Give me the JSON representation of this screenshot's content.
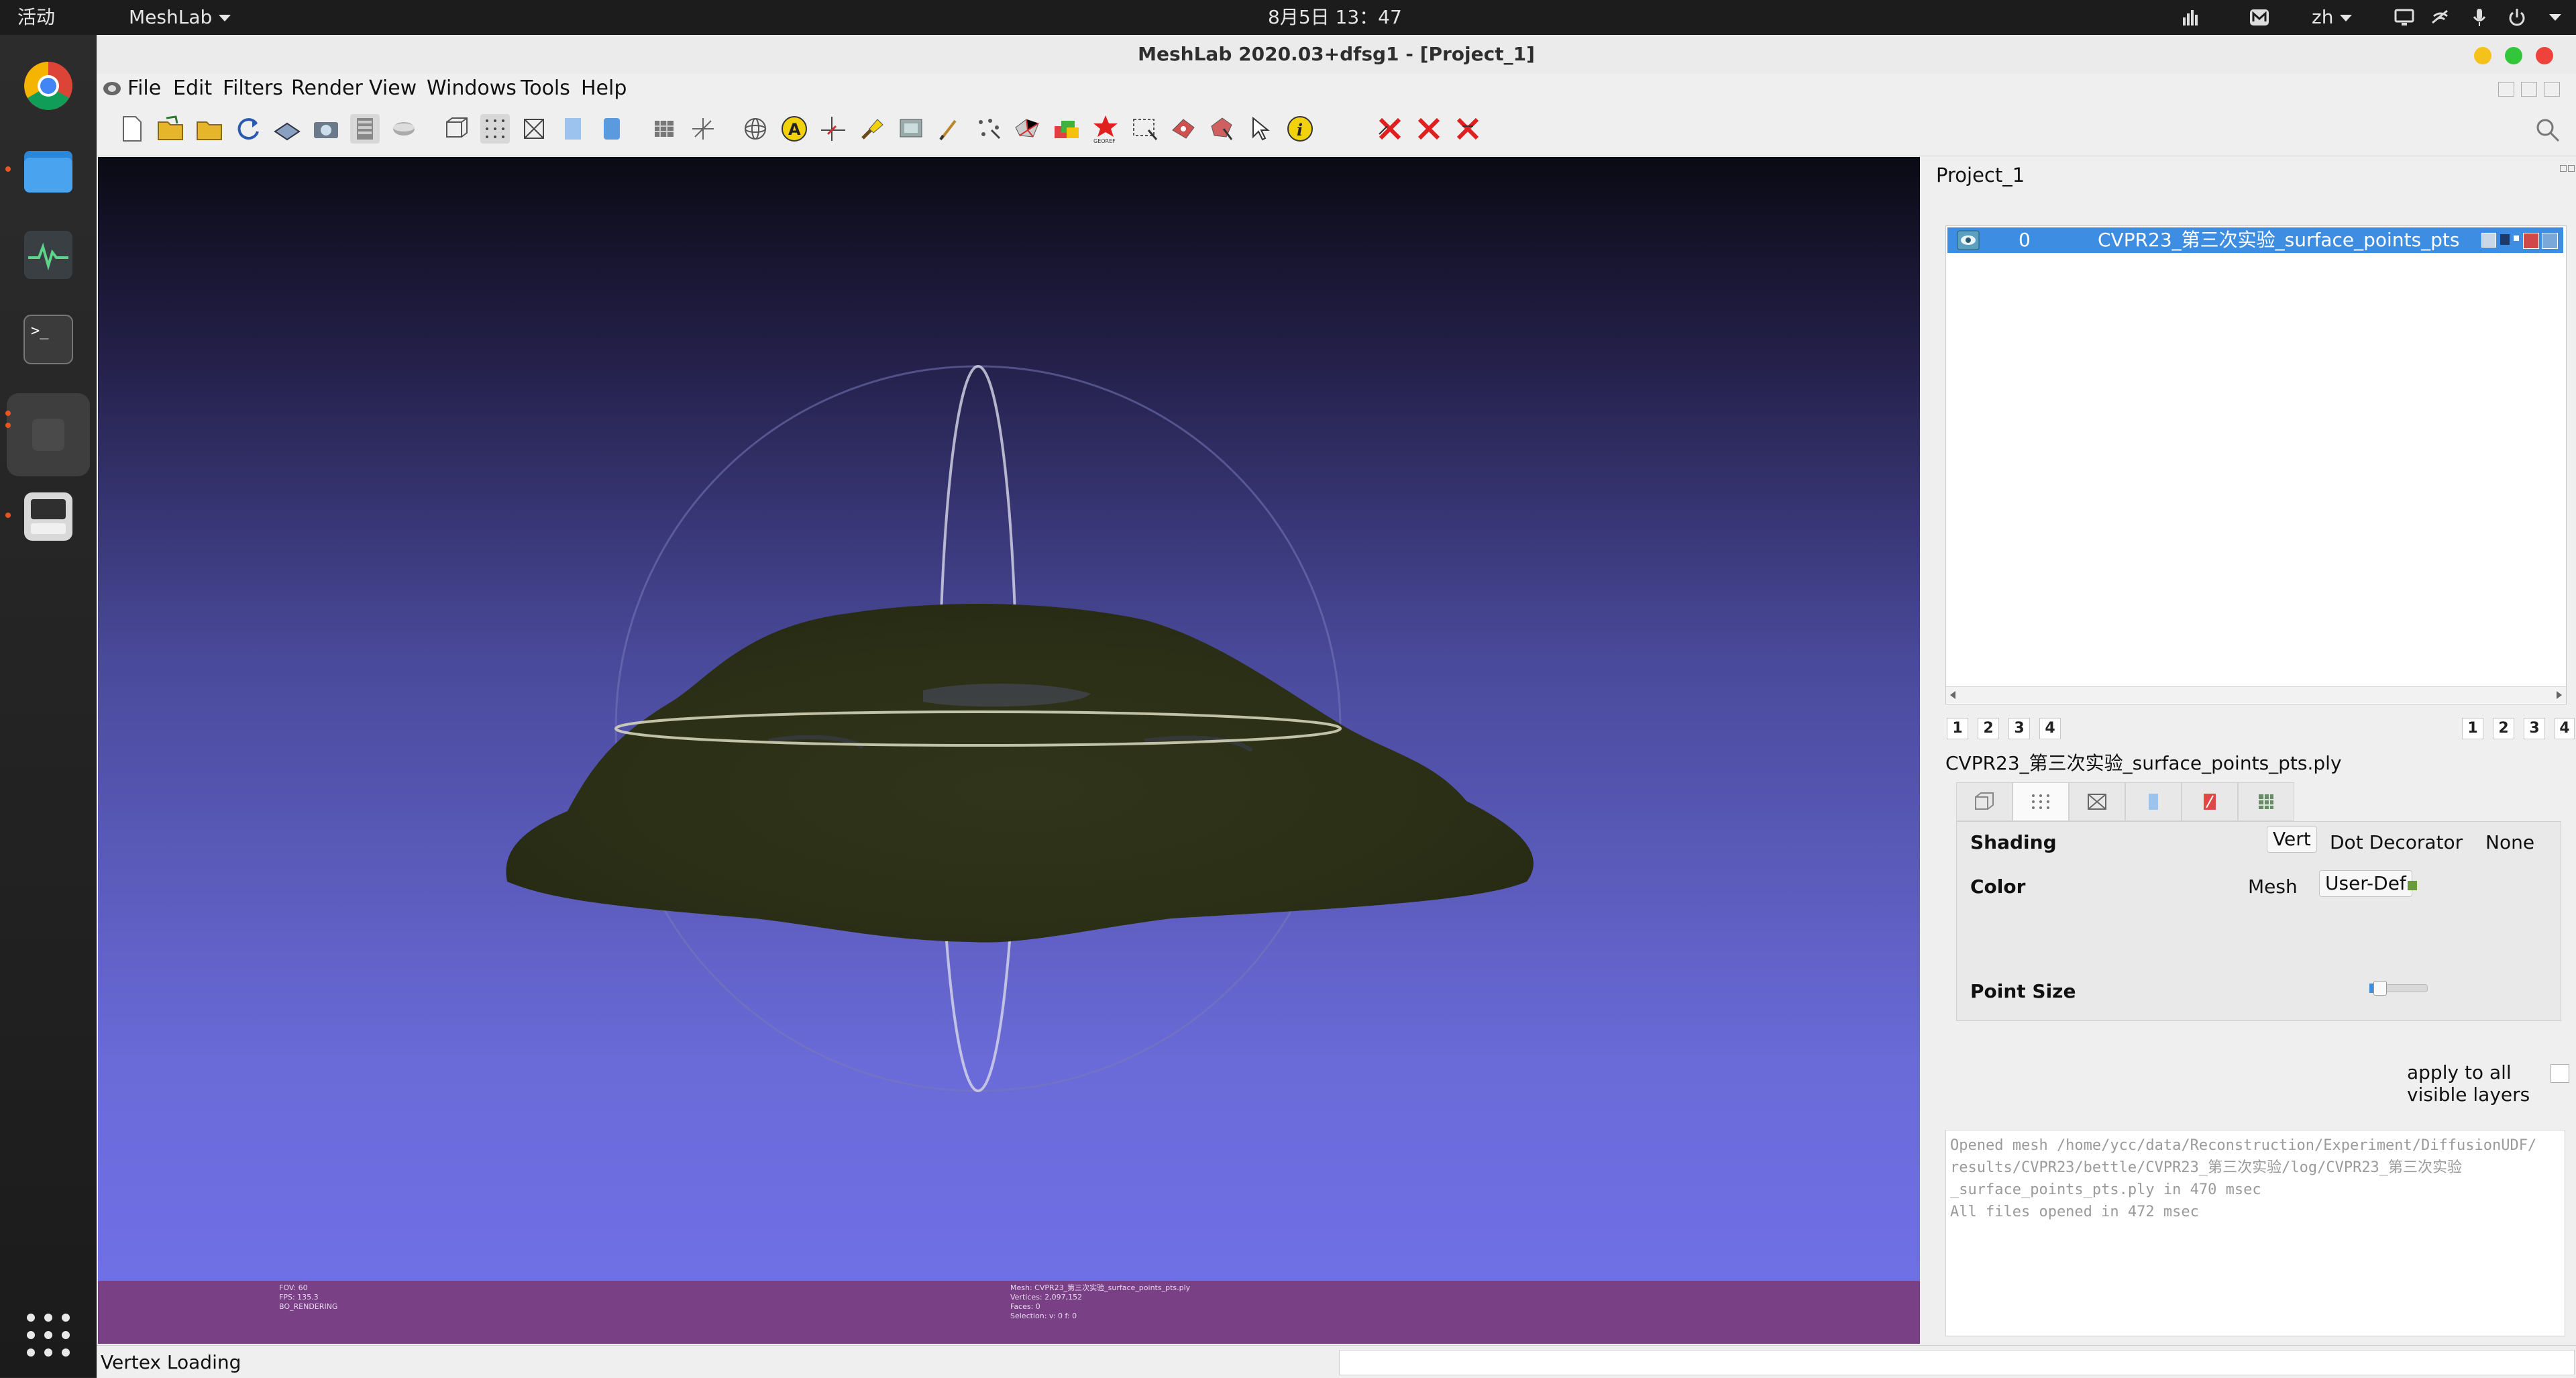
{
  "topbar": {
    "activities": "活动",
    "app_menu": "MeshLab",
    "clock": "8月5日 13：47",
    "input_method": "zh"
  },
  "window": {
    "title": "MeshLab 2020.03+dfsg1 - [Project_1]"
  },
  "menu": {
    "file": "File",
    "edit": "Edit",
    "filters": "Filters",
    "render": "Render",
    "view": "View",
    "windows": "Windows",
    "tools": "Tools",
    "help": "Help"
  },
  "toolbar": {
    "georef_label": "GEOREF"
  },
  "viewport": {
    "info_left": "FOV: 60\nFPS: 135.3\nBO_RENDERING",
    "info_right": "Mesh: CVPR23_第三次实验_surface_points_pts.ply\nVertices: 2,097,152\nFaces: 0\nSelection: v: 0 f: 0"
  },
  "project": {
    "title": "Project_1",
    "layers": [
      {
        "index": "0",
        "name": "CVPR23_第三次实验_surface_points_pts"
      }
    ],
    "pager_left": [
      "1",
      "2",
      "3",
      "4"
    ],
    "pager_right": [
      "1",
      "2",
      "3",
      "4"
    ]
  },
  "properties": {
    "file_name": "CVPR23_第三次实验_surface_points_pts.ply",
    "shading_label": "Shading",
    "shading_options": [
      "Vert",
      "Dot Decorator",
      "None"
    ],
    "color_label": "Color",
    "color_mesh": "Mesh",
    "color_userdef": "User-Def",
    "point_size_label": "Point Size",
    "apply_all": "apply to all visible layers"
  },
  "log": {
    "text": "Opened mesh /home/ycc/data/Reconstruction/Experiment/DiffusionUDF/\nresults/CVPR23/bettle/CVPR23_第三次实验/log/CVPR23_第三次实验\n_surface_points_pts.ply in 470 msec\nAll files opened in 472 msec"
  },
  "status": {
    "text": "Vertex Loading"
  },
  "colors": {
    "selection": "#3d8ee2",
    "info_bar": "#7a4086",
    "point_cloud": "#2f3316",
    "accent_orange": "#e95420"
  }
}
